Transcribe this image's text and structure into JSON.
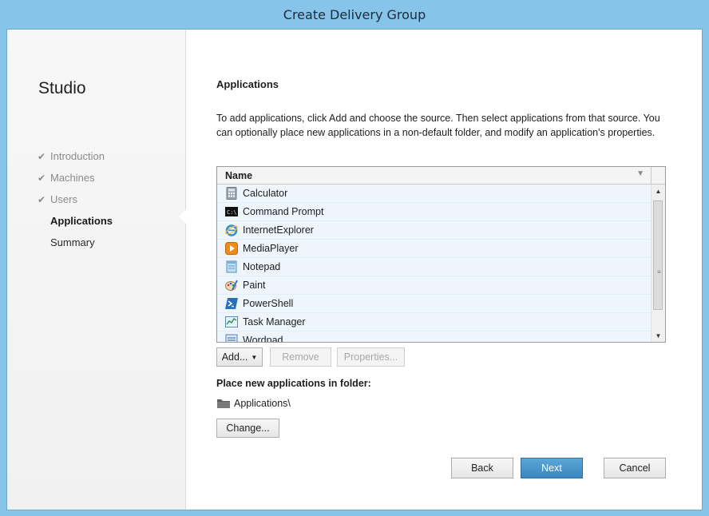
{
  "window": {
    "title": "Create Delivery Group"
  },
  "sidebar": {
    "product": "Studio",
    "steps": [
      {
        "label": "Introduction",
        "state": "done"
      },
      {
        "label": "Machines",
        "state": "done"
      },
      {
        "label": "Users",
        "state": "done"
      },
      {
        "label": "Applications",
        "state": "active"
      },
      {
        "label": "Summary",
        "state": "future"
      }
    ]
  },
  "main": {
    "title": "Applications",
    "description": "To add applications, click Add and choose the source. Then select applications from that source. You can optionally place new applications in a non-default folder, and modify an application's properties.",
    "list": {
      "column": "Name",
      "items": [
        {
          "name": "Calculator",
          "icon": "calculator-icon"
        },
        {
          "name": "Command Prompt",
          "icon": "command-prompt-icon"
        },
        {
          "name": "InternetExplorer",
          "icon": "internet-explorer-icon"
        },
        {
          "name": "MediaPlayer",
          "icon": "media-player-icon"
        },
        {
          "name": "Notepad",
          "icon": "notepad-icon"
        },
        {
          "name": "Paint",
          "icon": "paint-icon"
        },
        {
          "name": "PowerShell",
          "icon": "powershell-icon"
        },
        {
          "name": "Task Manager",
          "icon": "task-manager-icon"
        },
        {
          "name": "Wordpad",
          "icon": "wordpad-icon"
        }
      ]
    },
    "buttons": {
      "add": "Add...",
      "remove": "Remove",
      "properties": "Properties..."
    },
    "folder": {
      "label": "Place new applications in folder:",
      "path": "Applications\\",
      "change": "Change..."
    }
  },
  "footer": {
    "back": "Back",
    "next": "Next",
    "cancel": "Cancel"
  },
  "colors": {
    "accent": "#3a86c0",
    "frame": "#86c4ea",
    "row_selected": "#eef5fd"
  }
}
